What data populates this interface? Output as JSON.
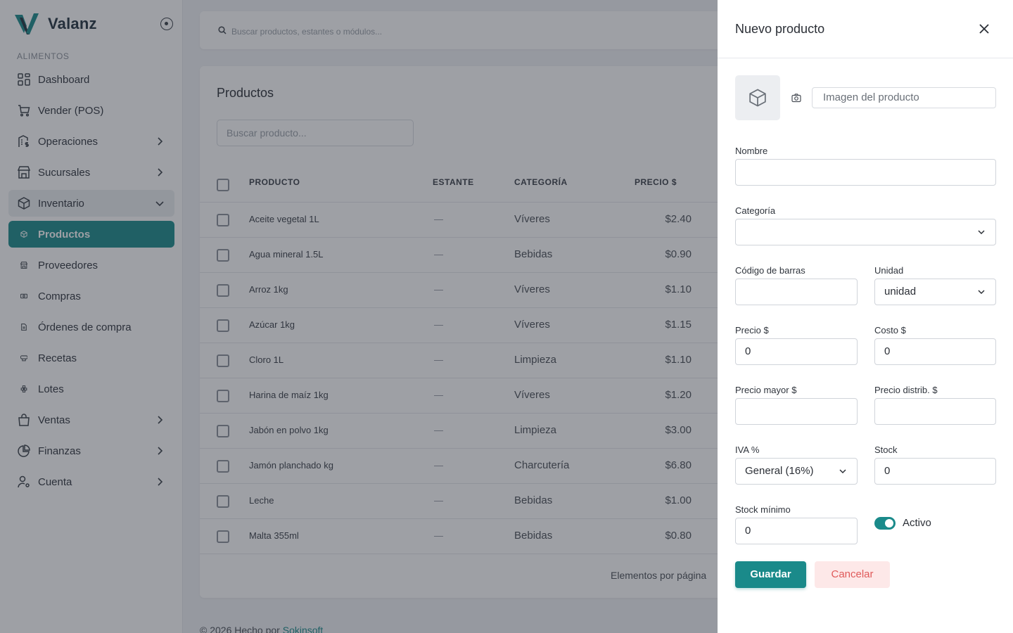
{
  "brand": {
    "name": "Valanz"
  },
  "sidebar": {
    "section": "ALIMENTOS",
    "items": [
      {
        "label": "Dashboard",
        "icon": "dashboard-icon",
        "chevron": ""
      },
      {
        "label": "Vender (POS)",
        "icon": "cart-icon",
        "chevron": ""
      },
      {
        "label": "Operaciones",
        "icon": "building-dollar-icon",
        "chevron": "right"
      },
      {
        "label": "Sucursales",
        "icon": "store-icon",
        "chevron": "right"
      },
      {
        "label": "Inventario",
        "icon": "box-icon",
        "chevron": "down"
      },
      {
        "label": "Productos",
        "icon": "box-icon",
        "chevron": ""
      },
      {
        "label": "Proveedores",
        "icon": "store-icon",
        "chevron": ""
      },
      {
        "label": "Compras",
        "icon": "cash-icon",
        "chevron": ""
      },
      {
        "label": "Órdenes de compra",
        "icon": "document-icon",
        "chevron": ""
      },
      {
        "label": "Recetas",
        "icon": "chef-hat-icon",
        "chevron": ""
      },
      {
        "label": "Lotes",
        "icon": "stack-icon",
        "chevron": ""
      },
      {
        "label": "Ventas",
        "icon": "shopping-bag-icon",
        "chevron": "right"
      },
      {
        "label": "Finanzas",
        "icon": "pie-chart-icon",
        "chevron": "right"
      },
      {
        "label": "Cuenta",
        "icon": "user-settings-icon",
        "chevron": "right"
      }
    ]
  },
  "topbar": {
    "search_placeholder": "Buscar productos, estantes o módulos..."
  },
  "products": {
    "title": "Productos",
    "search_placeholder": "Buscar producto...",
    "columns": [
      "PRODUCTO",
      "ESTANTE",
      "CATEGORÍA",
      "PRECIO $"
    ],
    "rows": [
      {
        "name": "Aceite vegetal 1L",
        "shelf": "—",
        "category": "Víveres",
        "price": "$2.40"
      },
      {
        "name": "Agua mineral 1.5L",
        "shelf": "—",
        "category": "Bebidas",
        "price": "$0.90"
      },
      {
        "name": "Arroz 1kg",
        "shelf": "—",
        "category": "Víveres",
        "price": "$1.10"
      },
      {
        "name": "Azúcar 1kg",
        "shelf": "—",
        "category": "Víveres",
        "price": "$1.15"
      },
      {
        "name": "Cloro 1L",
        "shelf": "—",
        "category": "Limpieza",
        "price": "$1.10"
      },
      {
        "name": "Harina de maíz 1kg",
        "shelf": "—",
        "category": "Víveres",
        "price": "$1.20"
      },
      {
        "name": "Jabón en polvo 1kg",
        "shelf": "—",
        "category": "Limpieza",
        "price": "$3.00"
      },
      {
        "name": "Jamón planchado kg",
        "shelf": "—",
        "category": "Charcutería",
        "price": "$6.80"
      },
      {
        "name": "Leche",
        "shelf": "—",
        "category": "Bebidas",
        "price": "$1.00"
      },
      {
        "name": "Malta 355ml",
        "shelf": "—",
        "category": "Bebidas",
        "price": "$0.80"
      }
    ],
    "per_page_label": "Elementos por página"
  },
  "footer": {
    "text": "© 2026 Hecho por ",
    "link": "Sokinsoft"
  },
  "drawer": {
    "title": "Nuevo producto",
    "image_placeholder": "Imagen del producto",
    "fields": {
      "nombre": {
        "label": "Nombre",
        "value": ""
      },
      "categoria": {
        "label": "Categoría",
        "value": ""
      },
      "codigo": {
        "label": "Código de barras",
        "value": ""
      },
      "unidad": {
        "label": "Unidad",
        "value": "unidad"
      },
      "precio": {
        "label": "Precio $",
        "value": "0"
      },
      "costo": {
        "label": "Costo $",
        "value": "0"
      },
      "precio_mayor": {
        "label": "Precio mayor $",
        "value": ""
      },
      "precio_distrib": {
        "label": "Precio distrib. $",
        "value": ""
      },
      "iva": {
        "label": "IVA %",
        "value": "General (16%)"
      },
      "stock": {
        "label": "Stock",
        "value": "0"
      },
      "stock_min": {
        "label": "Stock mínimo",
        "value": "0"
      }
    },
    "active_label": "Activo",
    "active": true,
    "save_label": "Guardar",
    "cancel_label": "Cancelar"
  },
  "colors": {
    "accent": "#1a8a8a",
    "danger_text": "#e05a5a",
    "danger_bg": "#fde8e8"
  }
}
